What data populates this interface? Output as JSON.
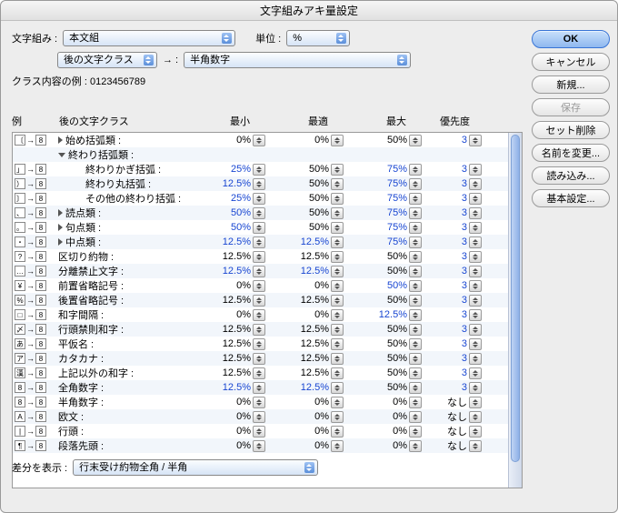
{
  "title": "文字組みアキ量設定",
  "topControls": {
    "mojikumi_label": "文字組み :",
    "mojikumi_value": "本文組",
    "unit_label": "単位 :",
    "unit_value": "%",
    "mode_value": "後の文字クラス",
    "arrow": "→ :",
    "target_value": "半角数字"
  },
  "example": {
    "label": "クラス内容の例 :",
    "value": "0123456789"
  },
  "headers": {
    "example": "例",
    "after_class": "後の文字クラス",
    "min": "最小",
    "opt": "最適",
    "max": "最大",
    "priority": "優先度"
  },
  "rows": [
    {
      "g1": "〔",
      "g2": "8",
      "tri": "closed",
      "indent": 0,
      "label": "始め括弧類 :",
      "min": "0%",
      "min_ch": false,
      "opt": "0%",
      "opt_ch": false,
      "max": "50%",
      "max_ch": false,
      "pri": "3"
    },
    {
      "g1": "",
      "g2": "",
      "tri": "open",
      "indent": 0,
      "label": "終わり括弧類 :",
      "min": "",
      "opt": "",
      "max": "",
      "pri": ""
    },
    {
      "g1": "」",
      "g2": "8",
      "tri": "",
      "indent": 1,
      "label": "終わりかぎ括弧 :",
      "min": "25%",
      "min_ch": true,
      "opt": "50%",
      "opt_ch": false,
      "max": "75%",
      "max_ch": true,
      "pri": "3"
    },
    {
      "g1": "）",
      "g2": "8",
      "tri": "",
      "indent": 1,
      "label": "終わり丸括弧 :",
      "min": "12.5%",
      "min_ch": true,
      "opt": "50%",
      "opt_ch": false,
      "max": "75%",
      "max_ch": true,
      "pri": "3"
    },
    {
      "g1": "〕",
      "g2": "8",
      "tri": "",
      "indent": 1,
      "label": "その他の終わり括弧 :",
      "min": "25%",
      "min_ch": true,
      "opt": "50%",
      "opt_ch": false,
      "max": "75%",
      "max_ch": true,
      "pri": "3"
    },
    {
      "g1": "、",
      "g2": "8",
      "tri": "closed",
      "indent": 0,
      "label": "読点類 :",
      "min": "50%",
      "min_ch": true,
      "opt": "50%",
      "opt_ch": false,
      "max": "75%",
      "max_ch": true,
      "pri": "3"
    },
    {
      "g1": "。",
      "g2": "8",
      "tri": "closed",
      "indent": 0,
      "label": "句点類 :",
      "min": "50%",
      "min_ch": true,
      "opt": "50%",
      "opt_ch": false,
      "max": "75%",
      "max_ch": true,
      "pri": "3"
    },
    {
      "g1": "・",
      "g2": "8",
      "tri": "closed",
      "indent": 0,
      "label": "中点類 :",
      "min": "12.5%",
      "min_ch": true,
      "opt": "12.5%",
      "opt_ch": true,
      "max": "75%",
      "max_ch": true,
      "pri": "3"
    },
    {
      "g1": "?",
      "g2": "8",
      "tri": "",
      "indent": 0,
      "label": "区切り約物 :",
      "min": "12.5%",
      "min_ch": false,
      "opt": "12.5%",
      "opt_ch": false,
      "max": "50%",
      "max_ch": false,
      "pri": "3"
    },
    {
      "g1": "…",
      "g2": "8",
      "tri": "",
      "indent": 0,
      "label": "分離禁止文字 :",
      "min": "12.5%",
      "min_ch": true,
      "opt": "12.5%",
      "opt_ch": true,
      "max": "50%",
      "max_ch": false,
      "pri": "3"
    },
    {
      "g1": "¥",
      "g2": "8",
      "tri": "",
      "indent": 0,
      "label": "前置省略記号 :",
      "min": "0%",
      "min_ch": false,
      "opt": "0%",
      "opt_ch": false,
      "max": "50%",
      "max_ch": true,
      "pri": "3"
    },
    {
      "g1": "%",
      "g2": "8",
      "tri": "",
      "indent": 0,
      "label": "後置省略記号 :",
      "min": "12.5%",
      "min_ch": false,
      "opt": "12.5%",
      "opt_ch": false,
      "max": "50%",
      "max_ch": false,
      "pri": "3"
    },
    {
      "g1": "□",
      "g2": "8",
      "tri": "",
      "indent": 0,
      "label": "和字間隔 :",
      "min": "0%",
      "min_ch": false,
      "opt": "0%",
      "opt_ch": false,
      "max": "12.5%",
      "max_ch": true,
      "pri": "3"
    },
    {
      "g1": "〆",
      "g2": "8",
      "tri": "",
      "indent": 0,
      "label": "行頭禁則和字 :",
      "min": "12.5%",
      "min_ch": false,
      "opt": "12.5%",
      "opt_ch": false,
      "max": "50%",
      "max_ch": false,
      "pri": "3"
    },
    {
      "g1": "あ",
      "g2": "8",
      "tri": "",
      "indent": 0,
      "label": "平仮名 :",
      "min": "12.5%",
      "min_ch": false,
      "opt": "12.5%",
      "opt_ch": false,
      "max": "50%",
      "max_ch": false,
      "pri": "3"
    },
    {
      "g1": "ア",
      "g2": "8",
      "tri": "",
      "indent": 0,
      "label": "カタカナ :",
      "min": "12.5%",
      "min_ch": false,
      "opt": "12.5%",
      "opt_ch": false,
      "max": "50%",
      "max_ch": false,
      "pri": "3"
    },
    {
      "g1": "漢",
      "g2": "8",
      "tri": "",
      "indent": 0,
      "label": "上記以外の和字 :",
      "min": "12.5%",
      "min_ch": false,
      "opt": "12.5%",
      "opt_ch": false,
      "max": "50%",
      "max_ch": false,
      "pri": "3"
    },
    {
      "g1": "8",
      "g2": "8",
      "tri": "",
      "indent": 0,
      "label": "全角数字 :",
      "min": "12.5%",
      "min_ch": true,
      "opt": "12.5%",
      "opt_ch": true,
      "max": "50%",
      "max_ch": false,
      "pri": "3"
    },
    {
      "g1": "8",
      "g2": "8",
      "tri": "",
      "indent": 0,
      "label": "半角数字 :",
      "min": "0%",
      "min_ch": false,
      "opt": "0%",
      "opt_ch": false,
      "max": "0%",
      "max_ch": false,
      "pri": "なし"
    },
    {
      "g1": "A",
      "g2": "8",
      "tri": "",
      "indent": 0,
      "label": "欧文 :",
      "min": "0%",
      "min_ch": false,
      "opt": "0%",
      "opt_ch": false,
      "max": "0%",
      "max_ch": false,
      "pri": "なし"
    },
    {
      "g1": "|",
      "g2": "8",
      "tri": "",
      "indent": 0,
      "label": "行頭 :",
      "min": "0%",
      "min_ch": false,
      "opt": "0%",
      "opt_ch": false,
      "max": "0%",
      "max_ch": false,
      "pri": "なし"
    },
    {
      "g1": "¶",
      "g2": "8",
      "tri": "",
      "indent": 0,
      "label": "段落先頭 :",
      "min": "0%",
      "min_ch": false,
      "opt": "0%",
      "opt_ch": false,
      "max": "0%",
      "max_ch": false,
      "pri": "なし"
    }
  ],
  "bottom": {
    "label": "差分を表示 :",
    "value": "行末受け約物全角 / 半角"
  },
  "buttons": {
    "ok": "OK",
    "cancel": "キャンセル",
    "new": "新規...",
    "save": "保存",
    "deleteSet": "セット削除",
    "rename": "名前を変更...",
    "import": "読み込み...",
    "basic": "基本設定..."
  }
}
